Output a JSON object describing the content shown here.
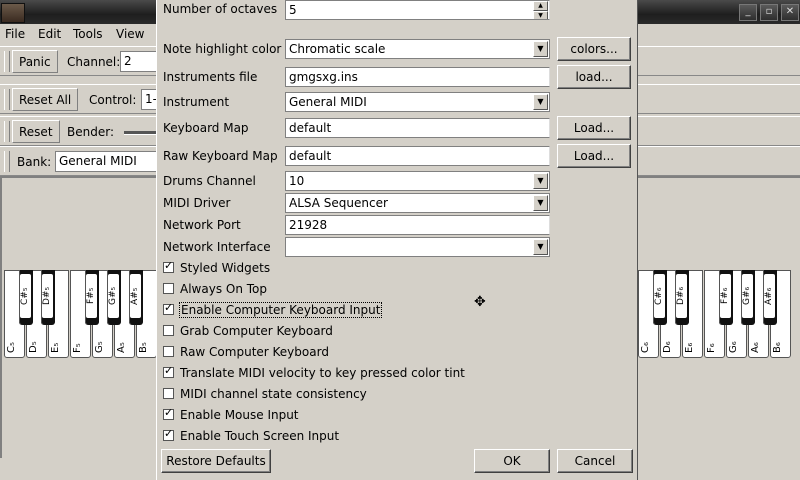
{
  "main_window": {
    "menu": [
      "File",
      "Edit",
      "Tools",
      "View"
    ],
    "toolbar1": {
      "panic_label": "Panic",
      "channel_label": "Channel:",
      "channel_value": "2"
    },
    "toolbar2": {
      "reset_all_label": "Reset All",
      "control_label": "Control:",
      "control_value": "1-"
    },
    "toolbar3": {
      "reset_label": "Reset",
      "bender_label": "Bender:"
    },
    "toolbar4": {
      "bank_label": "Bank:",
      "bank_value": "General MIDI"
    },
    "keyboard_left": {
      "white_keys": [
        "C₅",
        "D₅",
        "E₅",
        "F₅",
        "G₅",
        "A₅",
        "B₅"
      ],
      "black_keys": [
        "C#₅",
        "D#₅",
        "F#₅",
        "G#₅",
        "A#₅"
      ]
    },
    "keyboard_right": {
      "white_keys": [
        "C₆",
        "D₆",
        "E₆",
        "F₆",
        "G₆",
        "A₆",
        "B₆"
      ],
      "black_keys": [
        "C#₆",
        "D#₆",
        "F#₆",
        "G#₆",
        "A#₆"
      ]
    }
  },
  "dialog": {
    "number_of_octaves": {
      "label": "Number of octaves",
      "value": "5"
    },
    "note_highlight_color": {
      "label": "Note highlight color",
      "value": "Chromatic scale",
      "button": "colors..."
    },
    "instruments_file": {
      "label": "Instruments file",
      "value": "gmgsxg.ins",
      "button": "load..."
    },
    "instrument": {
      "label": "Instrument",
      "value": "General MIDI"
    },
    "keyboard_map": {
      "label": "Keyboard Map",
      "value": "default",
      "button": "Load..."
    },
    "raw_keyboard_map": {
      "label": "Raw Keyboard Map",
      "value": "default",
      "button": "Load..."
    },
    "drums_channel": {
      "label": "Drums Channel",
      "value": "10"
    },
    "midi_driver": {
      "label": "MIDI Driver",
      "value": "ALSA Sequencer"
    },
    "network_port": {
      "label": "Network Port",
      "value": "21928"
    },
    "network_interface": {
      "label": "Network Interface",
      "value": ""
    },
    "checkboxes": [
      {
        "label": "Styled Widgets",
        "checked": true
      },
      {
        "label": "Always On Top",
        "checked": false
      },
      {
        "label": "Enable Computer Keyboard Input",
        "checked": true
      },
      {
        "label": "Grab Computer Keyboard",
        "checked": false
      },
      {
        "label": "Raw Computer Keyboard",
        "checked": false
      },
      {
        "label": "Translate MIDI velocity to key pressed color tint",
        "checked": true
      },
      {
        "label": "MIDI channel state consistency",
        "checked": false
      },
      {
        "label": "Enable Mouse Input",
        "checked": true
      },
      {
        "label": "Enable Touch Screen Input",
        "checked": true
      }
    ],
    "restore_defaults_label": "Restore Defaults",
    "ok_label": "OK",
    "cancel_label": "Cancel"
  }
}
